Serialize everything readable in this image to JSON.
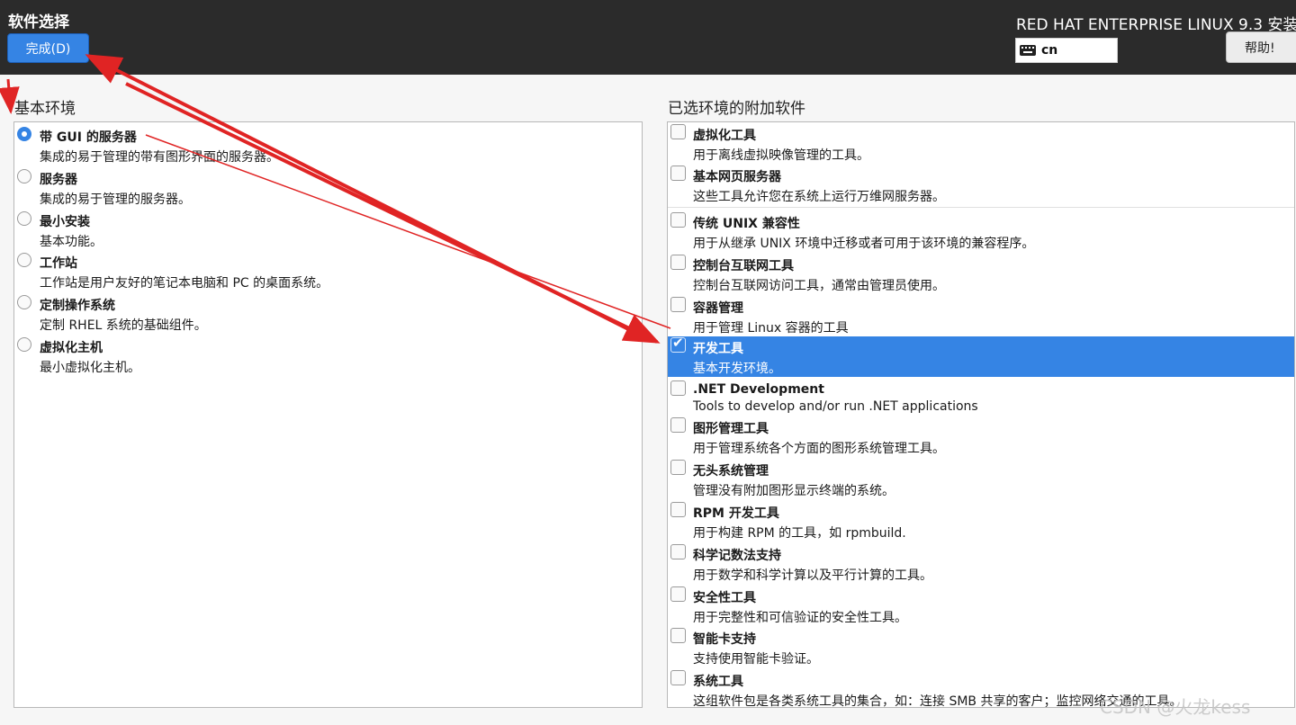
{
  "header": {
    "title": "软件选择",
    "done_label": "完成(D)",
    "product": "RED HAT ENTERPRISE LINUX 9.3 安装",
    "keyboard_layout": "cn",
    "help_label": "帮助!"
  },
  "base_environment": {
    "heading": "基本环境",
    "items": [
      {
        "title": "带 GUI 的服务器",
        "desc": "集成的易于管理的带有图形界面的服务器。",
        "selected": true
      },
      {
        "title": "服务器",
        "desc": "集成的易于管理的服务器。",
        "selected": false
      },
      {
        "title": "最小安装",
        "desc": "基本功能。",
        "selected": false
      },
      {
        "title": "工作站",
        "desc": "工作站是用户友好的笔记本电脑和 PC 的桌面系统。",
        "selected": false
      },
      {
        "title": "定制操作系统",
        "desc": "定制 RHEL 系统的基础组件。",
        "selected": false
      },
      {
        "title": "虚拟化主机",
        "desc": "最小虚拟化主机。",
        "selected": false
      }
    ]
  },
  "addons": {
    "heading": "已选环境的附加软件",
    "items": [
      {
        "title": "虚拟化工具",
        "desc": "用于离线虚拟映像管理的工具。",
        "checked": false
      },
      {
        "title": "基本网页服务器",
        "desc": "这些工具允许您在系统上运行万维网服务器。",
        "checked": false
      },
      {
        "title": "传统 UNIX 兼容性",
        "desc": "用于从继承 UNIX 环境中迁移或者可用于该环境的兼容程序。",
        "checked": false
      },
      {
        "title": "控制台互联网工具",
        "desc": "控制台互联网访问工具，通常由管理员使用。",
        "checked": false
      },
      {
        "title": "容器管理",
        "desc": "用于管理 Linux 容器的工具",
        "checked": false
      },
      {
        "title": "开发工具",
        "desc": "基本开发环境。",
        "checked": true
      },
      {
        "title": ".NET Development",
        "desc": "Tools to develop and/or run .NET applications",
        "checked": false
      },
      {
        "title": "图形管理工具",
        "desc": "用于管理系统各个方面的图形系统管理工具。",
        "checked": false
      },
      {
        "title": "无头系统管理",
        "desc": "管理没有附加图形显示终端的系统。",
        "checked": false
      },
      {
        "title": "RPM 开发工具",
        "desc": "用于构建 RPM 的工具，如 rpmbuild.",
        "checked": false
      },
      {
        "title": "科学记数法支持",
        "desc": "用于数学和科学计算以及平行计算的工具。",
        "checked": false
      },
      {
        "title": "安全性工具",
        "desc": "用于完整性和可信验证的安全性工具。",
        "checked": false
      },
      {
        "title": "智能卡支持",
        "desc": "支持使用智能卡验证。",
        "checked": false
      },
      {
        "title": "系统工具",
        "desc": "这组软件包是各类系统工具的集合，如：连接 SMB 共享的客户；监控网络交通的工具。",
        "checked": false
      }
    ]
  },
  "watermark": "CSDN @火龙kess",
  "colors": {
    "header_bg": "#2b2b2b",
    "accent": "#3584e4",
    "annotation_arrow": "#e02424"
  }
}
